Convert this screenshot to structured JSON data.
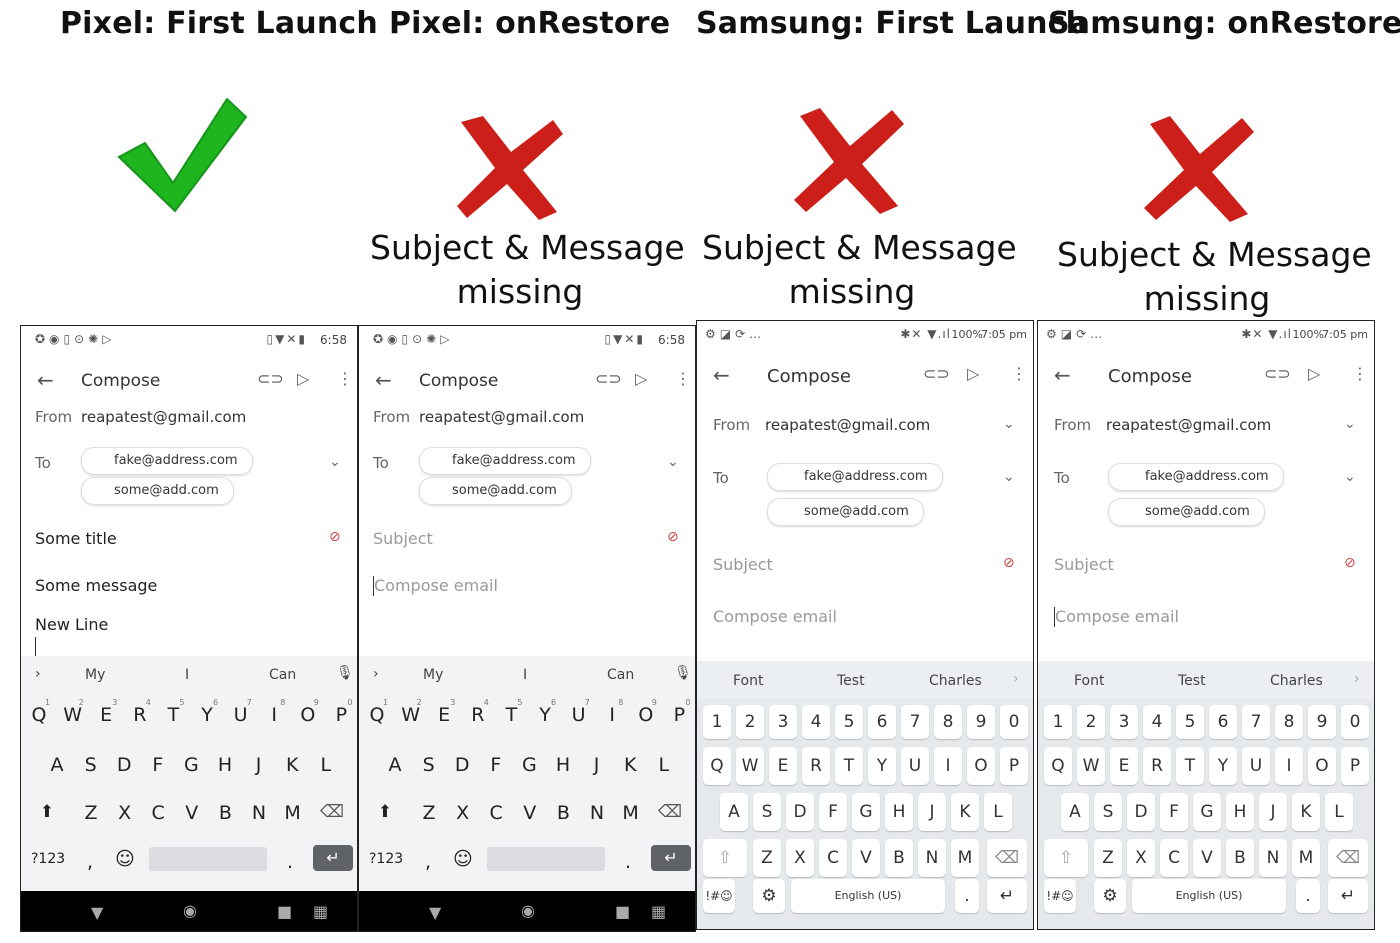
{
  "headings": {
    "pixel_first": "Pixel: First Launch",
    "pixel_restore": "Pixel: onRestore",
    "samsung_first": "Samsung: First Launch",
    "samsung_restore": "Samsung: onRestore"
  },
  "captions": {
    "pixel_restore": [
      "Subject & Message",
      "missing"
    ],
    "samsung_first": [
      "Subject & Message",
      "missing"
    ],
    "samsung_restore": [
      "Subject & Message",
      "missing"
    ]
  },
  "colors": {
    "check": "#1fb51f",
    "cross": "#cc1f1a"
  },
  "compose": {
    "title": "Compose",
    "from_label": "From",
    "from_value": "reapatest@gmail.com",
    "to_label": "To",
    "recipients": [
      "fake@address.com",
      "some@add.com"
    ],
    "subject_placeholder": "Subject",
    "body_placeholder": "Compose email"
  },
  "phone1": {
    "subject_value": "Some title",
    "body_line1": "Some message",
    "body_line2": "New Line"
  },
  "pixel_status": {
    "time": "6:58"
  },
  "samsung_status": {
    "time": "7:05 pm",
    "battery": "100%"
  },
  "pixel_keyboard": {
    "suggestions": [
      "My",
      "I",
      "Can"
    ],
    "row1": [
      "Q",
      "W",
      "E",
      "R",
      "T",
      "Y",
      "U",
      "I",
      "O",
      "P"
    ],
    "row1_hints": [
      "1",
      "2",
      "3",
      "4",
      "5",
      "6",
      "7",
      "8",
      "9",
      "0"
    ],
    "row2": [
      "A",
      "S",
      "D",
      "F",
      "G",
      "H",
      "J",
      "K",
      "L"
    ],
    "row3": [
      "Z",
      "X",
      "C",
      "V",
      "B",
      "N",
      "M"
    ],
    "sym_label": "?123",
    "comma": ",",
    "period": "."
  },
  "samsung_keyboard": {
    "suggestions": [
      "Font",
      "Test",
      "Charles"
    ],
    "numbers": [
      "1",
      "2",
      "3",
      "4",
      "5",
      "6",
      "7",
      "8",
      "9",
      "0"
    ],
    "row1": [
      "Q",
      "W",
      "E",
      "R",
      "T",
      "Y",
      "U",
      "I",
      "O",
      "P"
    ],
    "row2": [
      "A",
      "S",
      "D",
      "F",
      "G",
      "H",
      "J",
      "K",
      "L"
    ],
    "row3": [
      "Z",
      "X",
      "C",
      "V",
      "B",
      "N",
      "M"
    ],
    "sym_label": "!#☺",
    "space_label": "English (US)",
    "period": "."
  }
}
